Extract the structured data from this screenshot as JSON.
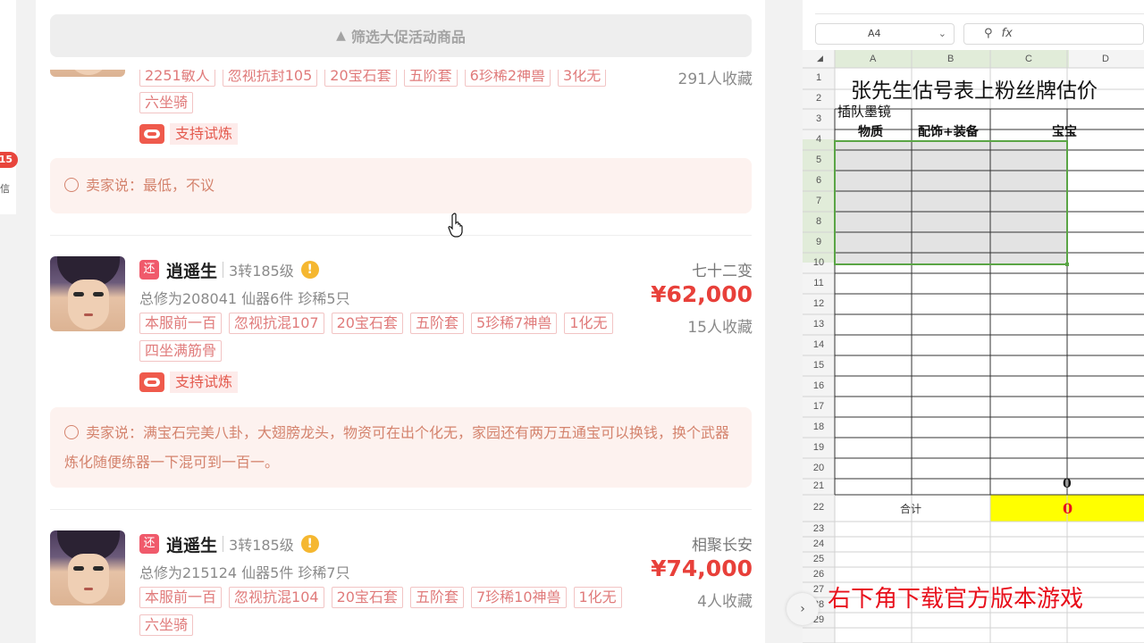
{
  "left_edge": {
    "badge": "15",
    "char": "信"
  },
  "filter": {
    "label": "筛选大促活动商品"
  },
  "listings": [
    {
      "tags_row1": [
        "2251敏人",
        "忽视抗封105",
        "20宝石套",
        "五阶套",
        "6珍稀2神兽",
        "3化无"
      ],
      "tags_row2": [
        "六坐骑"
      ],
      "favs": "291人收藏",
      "trial": "支持试炼",
      "seller": "卖家说：最低，不议"
    },
    {
      "badge": "还",
      "name": "逍遥生",
      "level": "3转185级",
      "stats": "总修为208041  仙器6件  珍稀5只",
      "server": "七十二变",
      "price": "¥62,000",
      "tags_row1": [
        "本服前一百",
        "忽视抗混107",
        "20宝石套",
        "五阶套",
        "5珍稀7神兽",
        "1化无"
      ],
      "tags_row2": [
        "四坐满筋骨"
      ],
      "favs": "15人收藏",
      "trial": "支持试炼",
      "seller": "卖家说：满宝石完美八卦，大翅膀龙头，物资可在出个化无，家园还有两万五通宝可以换钱，换个武器炼化随便练器一下混可到一百一。"
    },
    {
      "badge": "还",
      "name": "逍遥生",
      "level": "3转185级",
      "stats": "总修为215124  仙器5件  珍稀7只",
      "server": "相聚长安",
      "price": "¥74,000",
      "tags_row1": [
        "本服前一百",
        "忽视抗混104",
        "20宝石套",
        "五阶套",
        "7珍稀10神兽",
        "1化无"
      ],
      "tags_row2": [
        "六坐骑"
      ],
      "favs": "4人收藏"
    }
  ],
  "sheet": {
    "cell_ref": "A4",
    "fx": "fx",
    "columns": [
      "A",
      "B",
      "C",
      "D"
    ],
    "title": "张先生估号表上粉丝牌估价",
    "row2": "插队墨镜",
    "headers": [
      "物质",
      "配饰+装备",
      "宝宝"
    ],
    "row20_value": "0",
    "total_label": "合计",
    "total_value": "0",
    "rows": [
      "1",
      "2",
      "3",
      "4",
      "5",
      "6",
      "7",
      "8",
      "9",
      "10",
      "11",
      "12",
      "13",
      "14",
      "15",
      "16",
      "17",
      "18",
      "19",
      "20",
      "21",
      "22",
      "23",
      "24",
      "25",
      "26",
      "27",
      "28",
      "29"
    ]
  },
  "caption": "右下角下载官方版本游戏",
  "colors": {
    "price": "#e8403a",
    "tag": "#e07b7b",
    "seller_bg": "#fdf2ef",
    "total_fill": "#ffff00",
    "caption": "#e8101c",
    "selection": "#5aa545"
  }
}
